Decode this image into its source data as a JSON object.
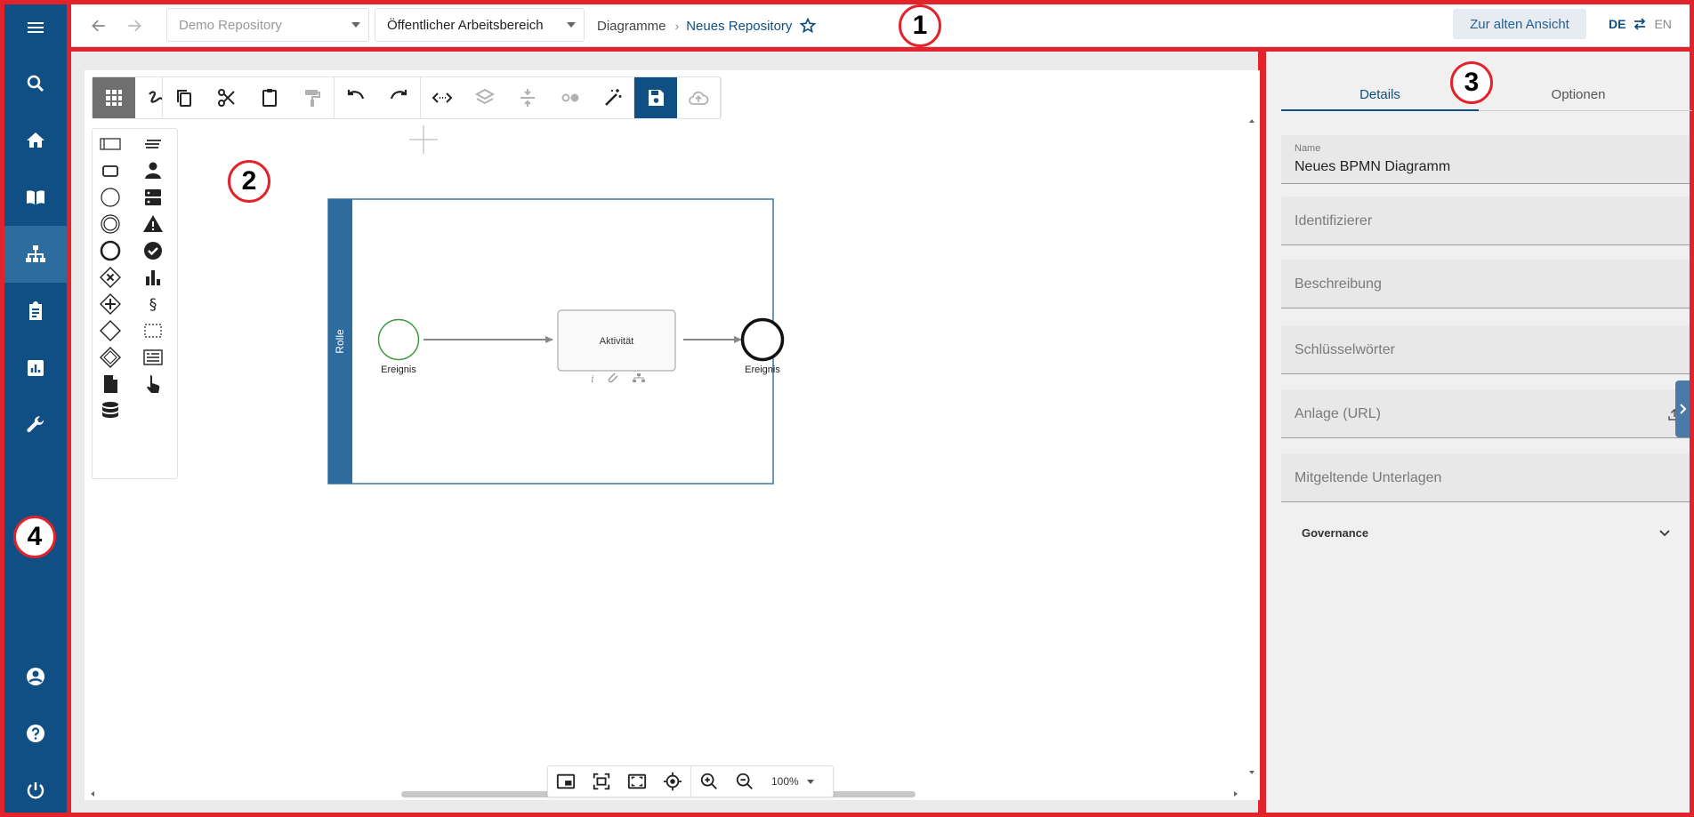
{
  "colors": {
    "frame": "#e3232b",
    "sidebar": "#0f4f84",
    "accent": "#0f4f84",
    "pool": "#2f6c9e",
    "start_event": "#3c9a3c"
  },
  "sidebar": {
    "items": [
      {
        "icon": "menu-icon"
      },
      {
        "icon": "search-icon"
      },
      {
        "icon": "home-icon"
      },
      {
        "icon": "book-icon"
      },
      {
        "icon": "sitemap-icon",
        "active": true
      },
      {
        "icon": "clipboard-icon"
      },
      {
        "icon": "bar-chart-icon"
      },
      {
        "icon": "wrench-icon"
      },
      {
        "icon": "account-icon"
      },
      {
        "icon": "help-icon"
      },
      {
        "icon": "power-icon"
      }
    ]
  },
  "header": {
    "repository": "Demo Repository",
    "workspace": "Öffentlicher Arbeitsbereich",
    "breadcrumb": [
      "Diagramme",
      "Neues Repository"
    ],
    "old_view": "Zur alten Ansicht",
    "lang_de": "DE",
    "lang_en": "EN"
  },
  "diagram": {
    "lane_label": "Rolle",
    "start_label": "Ereignis",
    "task_label": "Aktivität",
    "end_label": "Ereignis"
  },
  "zoom": {
    "level": "100%"
  },
  "panel": {
    "tabs": [
      "Details",
      "Optionen"
    ],
    "fields": [
      {
        "label": "Name",
        "value": "Neues BPMN Diagramm"
      },
      {
        "label": "Identifizierer"
      },
      {
        "label": "Beschreibung"
      },
      {
        "label": "Schlüsselwörter"
      },
      {
        "label": "Anlage (URL)"
      },
      {
        "label": "Mitgeltende Unterlagen"
      }
    ],
    "governance": "Governance"
  },
  "markers": [
    "1",
    "2",
    "3",
    "4"
  ]
}
